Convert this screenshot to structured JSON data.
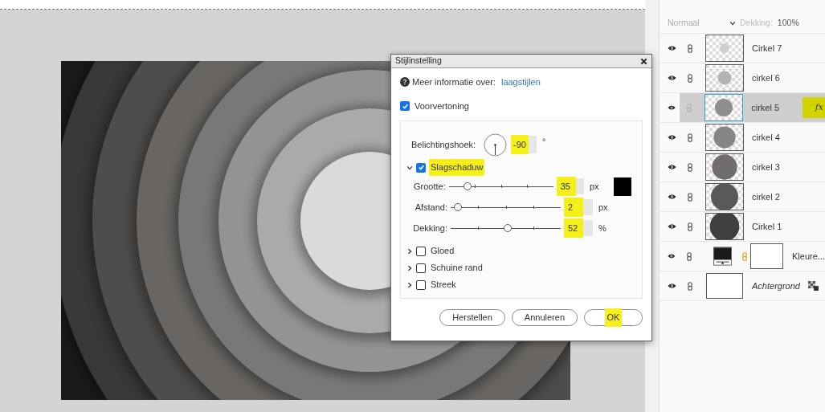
{
  "dialog": {
    "title": "Stijlinstelling",
    "info": {
      "text": "Meer informatie over:",
      "link": "laagstijlen"
    },
    "preview": {
      "label": "Voorvertoning",
      "checked": true
    },
    "angle": {
      "label": "Belichtingshoek:",
      "value": "-90",
      "unit": "°",
      "highlighted": true
    },
    "effects": [
      {
        "label": "Slagschaduw",
        "checked": true,
        "expanded": true,
        "highlighted": true,
        "settings": [
          {
            "label": "Grootte:",
            "level": 0.15,
            "value": "35",
            "unit": "px",
            "highlighted": true,
            "swatch": true
          },
          {
            "label": "Afstand:",
            "level": 0.03,
            "value": "2",
            "unit": "px",
            "highlighted": true
          },
          {
            "label": "Dekking:",
            "level": 0.52,
            "value": "52",
            "unit": "%",
            "highlighted": true
          }
        ]
      },
      {
        "label": "Gloed",
        "checked": false,
        "expanded": false,
        "highlighted": false
      },
      {
        "label": "Schuine rand",
        "checked": false,
        "expanded": false,
        "highlighted": false
      },
      {
        "label": "Streek",
        "checked": false,
        "expanded": false,
        "highlighted": false
      }
    ],
    "buttons": [
      {
        "label": "Herstellen",
        "highlighted": false
      },
      {
        "label": "Annuleren",
        "highlighted": false
      },
      {
        "label": "OK",
        "highlighted": true
      }
    ]
  },
  "layers_panel": {
    "blend_mode": "Normaal",
    "opacity_label": "Dekking:",
    "opacity_value": "100%",
    "layers": [
      {
        "kind": "circle",
        "name": "Cirkel 7",
        "color": "#cfcfcf",
        "selected": false
      },
      {
        "kind": "circle",
        "name": "cirkel 6",
        "color": "#b4b4b4",
        "selected": false
      },
      {
        "kind": "circle",
        "name": "cirkel 5",
        "color": "#8e8e8e",
        "selected": true,
        "fx": "fx"
      },
      {
        "kind": "circle",
        "name": "cirkel 4",
        "color": "#858585",
        "selected": false
      },
      {
        "kind": "circle",
        "name": "cirkel 3",
        "color": "#706d6b",
        "selected": false
      },
      {
        "kind": "circle",
        "name": "cirkel 2",
        "color": "#5a5958",
        "selected": false
      },
      {
        "kind": "circle",
        "name": "Cirkel 1",
        "color": "#404040",
        "selected": false
      },
      {
        "kind": "adjustment",
        "name": "Kleure...",
        "selected": false
      },
      {
        "kind": "background",
        "name": "Achtergrond",
        "selected": false
      }
    ]
  }
}
